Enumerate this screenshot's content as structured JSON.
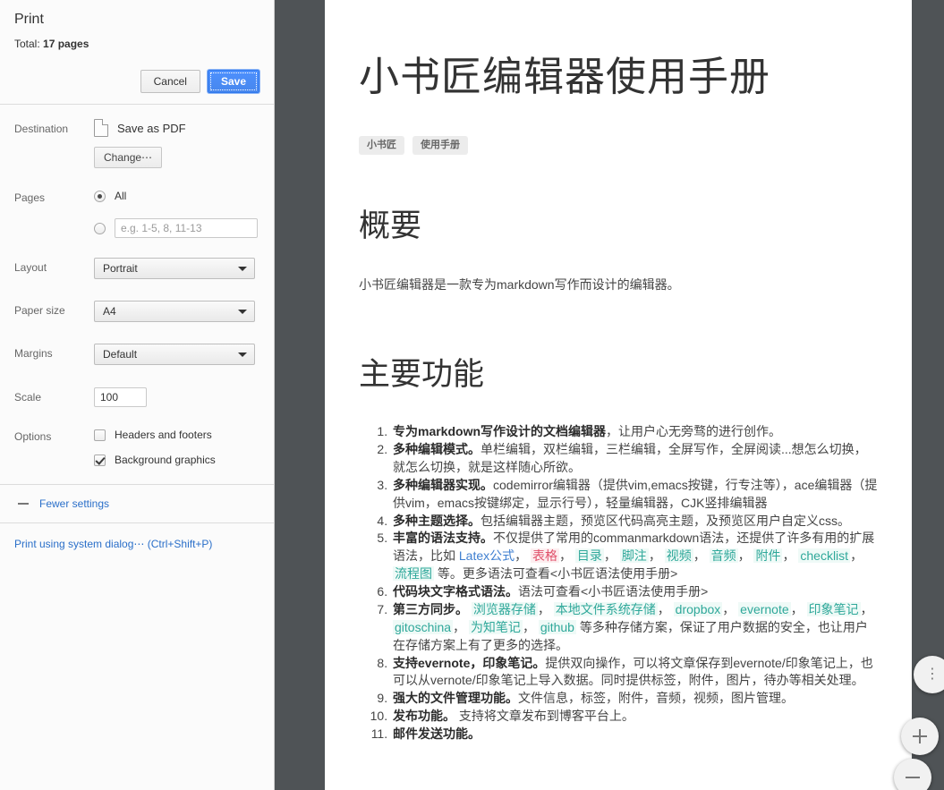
{
  "print_dialog": {
    "title": "Print",
    "total_prefix": "Total: ",
    "total_value": "17 pages",
    "cancel_label": "Cancel",
    "save_label": "Save",
    "destination": {
      "label": "Destination",
      "icon": "document-icon",
      "value": "Save as PDF",
      "change_label": "Change⋯"
    },
    "pages": {
      "label": "Pages",
      "all_label": "All",
      "all_selected": true,
      "custom_selected": false,
      "custom_placeholder": "e.g. 1-5, 8, 11-13",
      "custom_value": ""
    },
    "layout": {
      "label": "Layout",
      "value": "Portrait"
    },
    "paper_size": {
      "label": "Paper size",
      "value": "A4"
    },
    "margins": {
      "label": "Margins",
      "value": "Default"
    },
    "scale": {
      "label": "Scale",
      "value": "100"
    },
    "options": {
      "label": "Options",
      "headers_footers_label": "Headers and footers",
      "headers_footers_checked": false,
      "background_graphics_label": "Background graphics",
      "background_graphics_checked": true
    },
    "fewer_settings_label": "Fewer settings",
    "system_dialog_label": "Print using system dialog⋯ (Ctrl+Shift+P)",
    "accent_color": "#4d90fe",
    "link_color": "#2a6fc9"
  },
  "preview": {
    "background_color": "#4f5356",
    "document": {
      "heading": "小书匠编辑器使用手册",
      "tags": [
        "小书匠",
        "使用手册"
      ],
      "section1_heading": "概要",
      "section1_paragraph": "小书匠编辑器是一款专为markdown写作而设计的编辑器。",
      "section2_heading": "主要功能",
      "features": [
        {
          "bold": "专为markdown写作设计的文档编辑器",
          "rest": "，让用户心无旁骛的进行创作。"
        },
        {
          "bold": "多种编辑模式。",
          "rest": "单栏编辑，双栏编辑，三栏编辑，全屏写作，全屏阅读...想怎么切换，就怎么切换，就是这样随心所欲。"
        },
        {
          "bold": "多种编辑器实现。",
          "rest": "codemirror编辑器（提供vim,emacs按键，行专注等），ace编辑器（提供vim，emacs按键绑定，显示行号），轻量编辑器，CJK竖排编辑器"
        },
        {
          "bold": "多种主题选择。",
          "rest": "包括编辑器主题，预览区代码高亮主题，及预览区用户自定义css。"
        },
        {
          "bold": "丰富的语法支持。",
          "rest": "不仅提供了常用的commanmarkdown语法，还提供了许多有用的扩展语法，比如",
          "links": [
            {
              "text": "Latex公式",
              "style": "blue"
            },
            {
              "text": "表格",
              "style": "red"
            },
            {
              "text": "目录",
              "style": "teal"
            },
            {
              "text": "脚注",
              "style": "teal"
            },
            {
              "text": "视频",
              "style": "teal"
            },
            {
              "text": "音频",
              "style": "teal"
            },
            {
              "text": "附件",
              "style": "teal"
            },
            {
              "text": "checklist",
              "style": "teal"
            },
            {
              "text": "流程图",
              "style": "teal"
            }
          ],
          "tail": "等。更多语法可查看<小书匠语法使用手册>"
        },
        {
          "bold": "代码块文字格式语法。",
          "rest": "语法可查看<小书匠语法使用手册>"
        },
        {
          "bold": "第三方同步。",
          "rest": "",
          "links": [
            {
              "text": "浏览器存储",
              "style": "teal"
            },
            {
              "text": "本地文件系统存储",
              "style": "teal"
            },
            {
              "text": "dropbox",
              "style": "teal"
            },
            {
              "text": "evernote",
              "style": "teal"
            },
            {
              "text": "印象笔记",
              "style": "teal"
            },
            {
              "text": "gitoschina",
              "style": "teal"
            },
            {
              "text": "为知笔记",
              "style": "teal"
            },
            {
              "text": "github",
              "style": "teal"
            }
          ],
          "tail": "等多种存储方案，保证了用户数据的安全，也让用户在存储方案上有了更多的选择。"
        },
        {
          "bold": "支持evernote，印象笔记。",
          "rest": "提供双向操作，可以将文章保存到evernote/印象笔记上，也可以从vernote/印象笔记上导入数据。同时提供标签，附件，图片，待办等相关处理。"
        },
        {
          "bold": "强大的文件管理功能。",
          "rest": "文件信息，标签，附件，音频，视频，图片管理。"
        },
        {
          "bold": "发布功能。",
          "rest": " 支持将文章发布到博客平台上。"
        },
        {
          "bold": "邮件发送功能。",
          "rest": ""
        }
      ]
    },
    "zoom_controls": {
      "more_label": "⋮",
      "zoom_in_label": "+",
      "zoom_out_label": "−"
    }
  }
}
